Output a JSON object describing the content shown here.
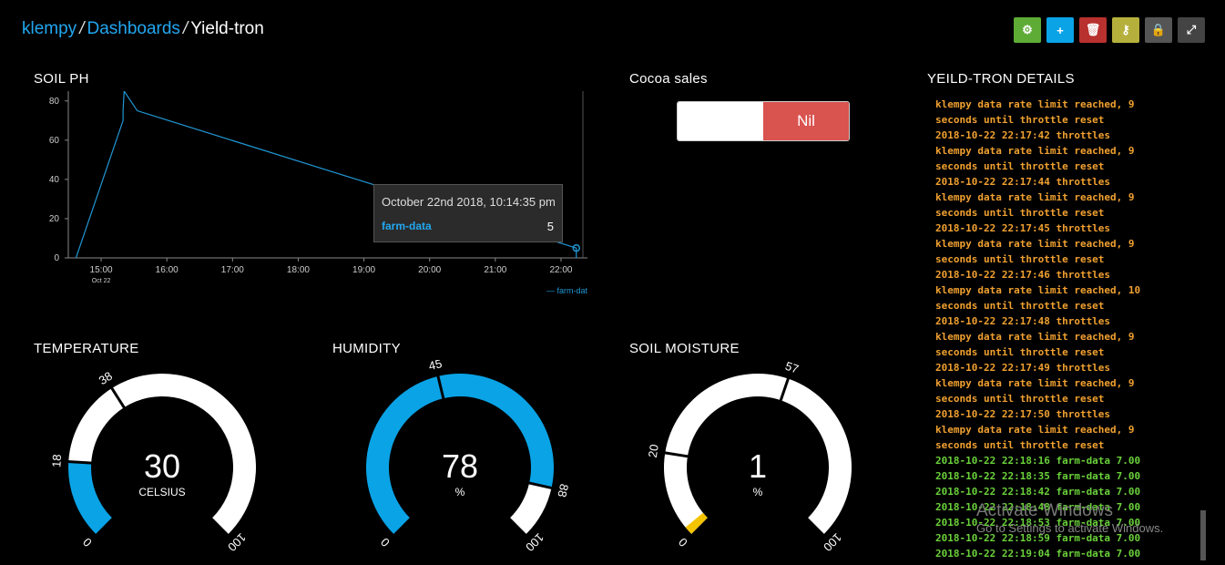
{
  "breadcrumb": {
    "user": "klempy",
    "section": "Dashboards",
    "current": "Yield-tron",
    "separator": "/"
  },
  "toolbar": [
    {
      "name": "settings-button",
      "icon": "gear-icon",
      "glyph": "⚙",
      "color": "#5eac36"
    },
    {
      "name": "add-button",
      "icon": "plus-icon",
      "glyph": "+",
      "color": "#0aa3e6"
    },
    {
      "name": "delete-button",
      "icon": "trash-icon",
      "glyph": "🗑",
      "color": "#b8312f"
    },
    {
      "name": "key-button",
      "icon": "key-icon",
      "glyph": "⚷",
      "color": "#b5b03b"
    },
    {
      "name": "lock-button",
      "icon": "lock-icon",
      "glyph": "🔒",
      "color": "#555555"
    },
    {
      "name": "fullscreen-button",
      "icon": "expand-icon",
      "glyph": "⤢",
      "color": "#444444"
    }
  ],
  "soil_ph": {
    "title": "SOIL PH",
    "tooltip": {
      "date": "October 22nd 2018, 10:14:35 pm",
      "series": "farm-data",
      "value": "5"
    },
    "legend": "— farm-data"
  },
  "chart_data": {
    "type": "line",
    "title": "SOIL PH",
    "x_ticks": [
      "15:00",
      "16:00",
      "17:00",
      "18:00",
      "19:00",
      "20:00",
      "21:00",
      "22:00"
    ],
    "x_sublabel": "Oct 22",
    "y_ticks": [
      0,
      20,
      40,
      60,
      80
    ],
    "ylim": [
      0,
      85
    ],
    "xlim": [
      "14:30",
      "22:20"
    ],
    "series": [
      {
        "name": "farm-data",
        "color": "#2196d3",
        "x": [
          "14:37",
          "15:20",
          "15:20",
          "15:21",
          "15:33",
          "22:14",
          "22:14",
          "22:14"
        ],
        "y": [
          0,
          70,
          75,
          85,
          75,
          5,
          0,
          5
        ]
      }
    ]
  },
  "cocoa": {
    "title": "Cocoa sales",
    "value": "Nil"
  },
  "details": {
    "title": "YEILD-TRON DETAILS",
    "lines": [
      {
        "t": "klempy data rate limit reached, 9",
        "c": "#f0a030"
      },
      {
        "t": "seconds until throttle reset",
        "c": "#f0a030"
      },
      {
        "t": "2018-10-22 22:17:42  throttles",
        "c": "#f0a030"
      },
      {
        "t": "klempy data rate limit reached, 9",
        "c": "#f0a030"
      },
      {
        "t": "seconds until throttle reset",
        "c": "#f0a030"
      },
      {
        "t": "2018-10-22 22:17:44  throttles",
        "c": "#f0a030"
      },
      {
        "t": "klempy data rate limit reached, 9",
        "c": "#f0a030"
      },
      {
        "t": "seconds until throttle reset",
        "c": "#f0a030"
      },
      {
        "t": "2018-10-22 22:17:45  throttles",
        "c": "#f0a030"
      },
      {
        "t": "klempy data rate limit reached, 9",
        "c": "#f0a030"
      },
      {
        "t": "seconds until throttle reset",
        "c": "#f0a030"
      },
      {
        "t": "2018-10-22 22:17:46  throttles",
        "c": "#f0a030"
      },
      {
        "t": "klempy data rate limit reached, 10",
        "c": "#f0a030"
      },
      {
        "t": "seconds until throttle reset",
        "c": "#f0a030"
      },
      {
        "t": "2018-10-22 22:17:48  throttles",
        "c": "#f0a030"
      },
      {
        "t": "klempy data rate limit reached, 9",
        "c": "#f0a030"
      },
      {
        "t": "seconds until throttle reset",
        "c": "#f0a030"
      },
      {
        "t": "2018-10-22 22:17:49  throttles",
        "c": "#f0a030"
      },
      {
        "t": "klempy data rate limit reached, 9",
        "c": "#f0a030"
      },
      {
        "t": "seconds until throttle reset",
        "c": "#f0a030"
      },
      {
        "t": "2018-10-22 22:17:50  throttles",
        "c": "#f0a030"
      },
      {
        "t": "klempy data rate limit reached, 9",
        "c": "#f0a030"
      },
      {
        "t": "seconds until throttle reset",
        "c": "#f0a030"
      },
      {
        "t": "2018-10-22 22:18:16  farm-data  7.00",
        "c": "#6ad13a"
      },
      {
        "t": "2018-10-22 22:18:35  farm-data  7.00",
        "c": "#6ad13a"
      },
      {
        "t": "2018-10-22 22:18:42  farm-data  7.00",
        "c": "#6ad13a"
      },
      {
        "t": "2018-10-22 22:18:48  farm-data  7.00",
        "c": "#6ad13a"
      },
      {
        "t": "2018-10-22 22:18:53  farm-data  7.00",
        "c": "#6ad13a"
      },
      {
        "t": "2018-10-22 22:18:59  farm-data  7.00",
        "c": "#6ad13a"
      },
      {
        "t": "2018-10-22 22:19:04  farm-data  7.00",
        "c": "#6ad13a"
      }
    ]
  },
  "gauges": [
    {
      "key": "temperature",
      "title": "TEMPERATURE",
      "value": "30",
      "unit": "CELSIUS",
      "min": 0,
      "max": 100,
      "low": 18,
      "high": 38,
      "min_label": "0",
      "max_label": "100",
      "low_label": "18",
      "high_label": "38",
      "low_color": "#0aa3e6",
      "mid_color": "#ffffff",
      "high_color": "#ffffff"
    },
    {
      "key": "humidity",
      "title": "HUMIDITY",
      "value": "78",
      "unit": "%",
      "min": 0,
      "max": 100,
      "low": 45,
      "high": 88,
      "min_label": "0",
      "max_label": "100",
      "low_label": "45",
      "high_label": "88",
      "low_color": "#0aa3e6",
      "mid_color": "#0aa3e6",
      "high_color": "#ffffff"
    },
    {
      "key": "soil_moisture",
      "title": "SOIL MOISTURE",
      "value": "1",
      "unit": "%",
      "min": 0,
      "max": 100,
      "low": 20,
      "high": 57,
      "min_label": "0",
      "max_label": "100",
      "low_label": "20",
      "high_label": "57",
      "low_color": "#ffffff",
      "mid_color": "#ffffff",
      "high_color": "#ffffff",
      "value_color": "#f5c400"
    }
  ],
  "watermark": {
    "line1": "Activate Windows",
    "line2": "Go to Settings to activate Windows."
  }
}
